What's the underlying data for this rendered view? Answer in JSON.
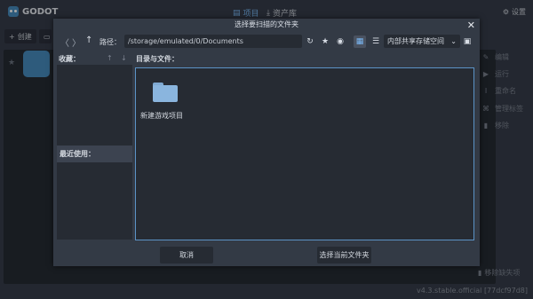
{
  "app": {
    "logo": "GODOT"
  },
  "tabs": [
    {
      "label": "项目",
      "icon": "list-icon"
    },
    {
      "label": "资产库",
      "icon": "download-icon"
    }
  ],
  "settings": {
    "label": "设置",
    "icon": "settings-icon"
  },
  "toolbar": {
    "create_label": "创建"
  },
  "right_actions": [
    {
      "label": "编辑",
      "icon": "edit-icon"
    },
    {
      "label": "运行",
      "icon": "play-icon"
    },
    {
      "label": "重命名",
      "icon": "rename-icon"
    },
    {
      "label": "管理标签",
      "icon": "tag-icon"
    },
    {
      "label": "移除",
      "icon": "trash-icon"
    }
  ],
  "remove_missing_label": "移除缺失项",
  "version": "v4.3.stable.official [77dcf97d8]",
  "dialog": {
    "title": "选择要扫描的文件夹",
    "path_label": "路径：",
    "path_value": "/storage/emulated/0/Documents",
    "drive_value": "内部共享存储空间",
    "favorites_label": "收藏：",
    "recent_label": "最近使用：",
    "files_label": "目录与文件：",
    "items": [
      {
        "name": "新建游戏项目",
        "icon": "folder-icon"
      }
    ],
    "cancel_label": "取消",
    "select_label": "选择当前文件夹"
  },
  "colors": {
    "accent": "#7ab8f5",
    "selection_border": "#5b93c6",
    "godot_blue": "#478cbf"
  }
}
